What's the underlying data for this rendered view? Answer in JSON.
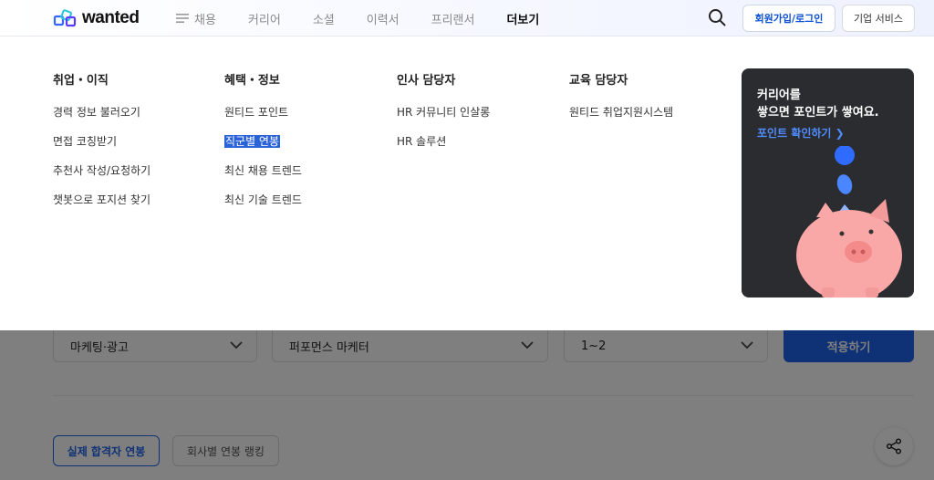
{
  "header": {
    "logo_text": "wanted",
    "nav": [
      {
        "label": "채용",
        "active": false
      },
      {
        "label": "커리어",
        "active": false
      },
      {
        "label": "소셜",
        "active": false
      },
      {
        "label": "이력서",
        "active": false
      },
      {
        "label": "프리랜서",
        "active": false
      },
      {
        "label": "더보기",
        "active": true
      }
    ],
    "login_label": "회원가입/로그인",
    "corp_label": "기업 서비스"
  },
  "dropdown": {
    "columns": [
      {
        "title": "취업・이직",
        "links": [
          "경력 정보 불러오기",
          "면접 코칭받기",
          "추천사 작성/요청하기",
          "챗봇으로 포지션 찾기"
        ]
      },
      {
        "title": "혜택・정보",
        "links": [
          "원티드 포인트",
          "직군별 연봉",
          "최신 채용 트렌드",
          "최신 기술 트렌드"
        ]
      },
      {
        "title": "인사 담당자",
        "links": [
          "HR 커뮤니티 인살롱",
          "HR 솔루션"
        ]
      },
      {
        "title": "교육 담당자",
        "links": [
          "원티드 취업지원시스템"
        ]
      }
    ],
    "promo": {
      "line1": "커리어를",
      "line2": "쌓으면 포인트가 쌓여요.",
      "link": "포인트 확인하기 ❯"
    }
  },
  "filters": {
    "job_group": "마케팅·광고",
    "job": "퍼포먼스 마케터",
    "years": "1~2",
    "apply_label": "적용하기"
  },
  "tabs": {
    "active": "실제 합격자 연봉",
    "inactive": "회사별 연봉 랭킹"
  },
  "colors": {
    "brand_blue": "#1e63ea",
    "highlight": "#2a62d8",
    "promo_bg": "#2b2c2f"
  },
  "icons": [
    "wanted-logo-icon",
    "menu-icon",
    "search-icon",
    "chevron-down-icon",
    "share-icon",
    "piggy-bank-icon"
  ]
}
